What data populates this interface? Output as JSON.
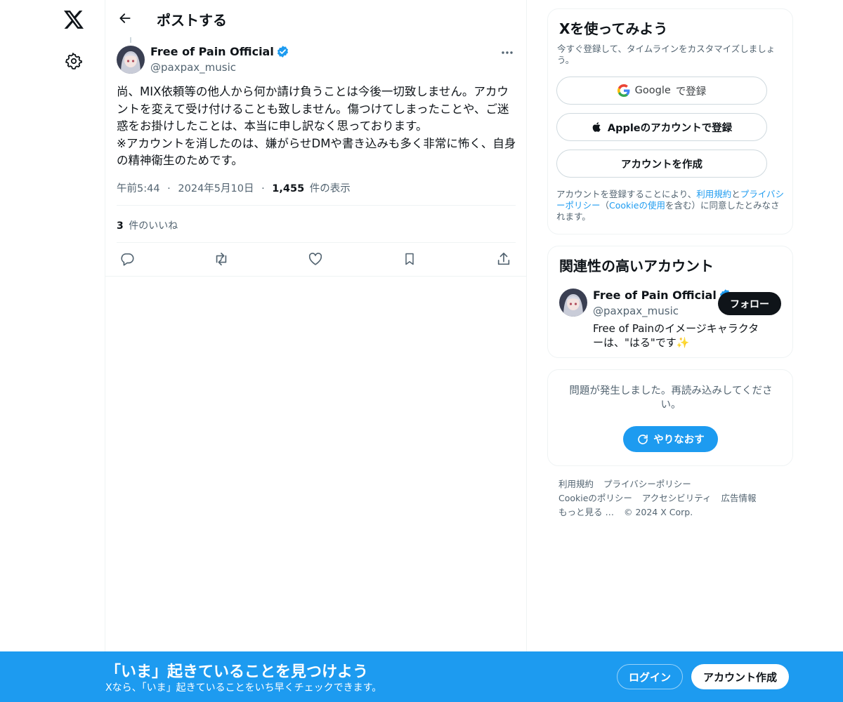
{
  "nav": {
    "logo_icon": "x-logo-icon",
    "settings_icon": "gear-icon"
  },
  "header": {
    "title": "ポストする",
    "back_icon": "arrow-left-icon"
  },
  "post": {
    "author_name": "Free of Pain Official",
    "author_handle": "@paxpax_music",
    "verified_color": "#1d9bf0",
    "text": "尚、MIX依頼等の他人から何か請け負うことは今後一切致しません。アカウントを変えて受け付けることも致しません。傷つけてしまったことや、ご迷惑をお掛けしたことは、本当に申し訳なく思っております。\n※アカウントを消したのは、嫌がらせDMや書き込みも多く非常に怖く、自身の精神衛生のためです。",
    "time": "午前5:44",
    "separator": "·",
    "date": "2024年5月10日",
    "views_count": "1,455",
    "views_label": "件の表示",
    "likes_count": "3",
    "likes_label": "件のいいね",
    "actions": [
      "reply-icon",
      "repost-icon",
      "like-icon",
      "bookmark-icon",
      "share-icon"
    ]
  },
  "signup_card": {
    "title": "Xを使ってみよう",
    "subtitle": "今すぐ登録して、タイムラインをカスタマイズしましょう。",
    "google_brand": "Google",
    "google_suffix": "で登録",
    "apple_label": "Appleのアカウントで登録",
    "create_label": "アカウントを作成",
    "terms_prefix": "アカウントを登録することにより、",
    "terms_link": "利用規約",
    "terms_and": "と",
    "privacy_link": "プライバシーポリシー",
    "terms_paren_open": "（",
    "cookie_link": "Cookieの使用",
    "terms_paren_close": "を含む）に同意したとみなされます。"
  },
  "related_card": {
    "title": "関連性の高いアカウント",
    "name": "Free of Pain Official",
    "handle": "@paxpax_music",
    "follow_label": "フォロー",
    "bio": "Free of Painのイメージキャラクターは、\"はる\"です✨"
  },
  "error_card": {
    "message": "問題が発生しました。再読み込みしてください。",
    "retry_label": "やりなおす"
  },
  "footer": {
    "links": [
      "利用規約",
      "プライバシーポリシー",
      "Cookieのポリシー",
      "アクセシビリティ",
      "広告情報",
      "もっと見る …",
      "© 2024 X Corp."
    ]
  },
  "banner": {
    "title": "「いま」起きていることを見つけよう",
    "subtitle": "Xなら、「いま」起きていることをいち早くチェックできます。",
    "login_label": "ログイン",
    "signup_label": "アカウント作成",
    "color": "#1d9bf0"
  }
}
